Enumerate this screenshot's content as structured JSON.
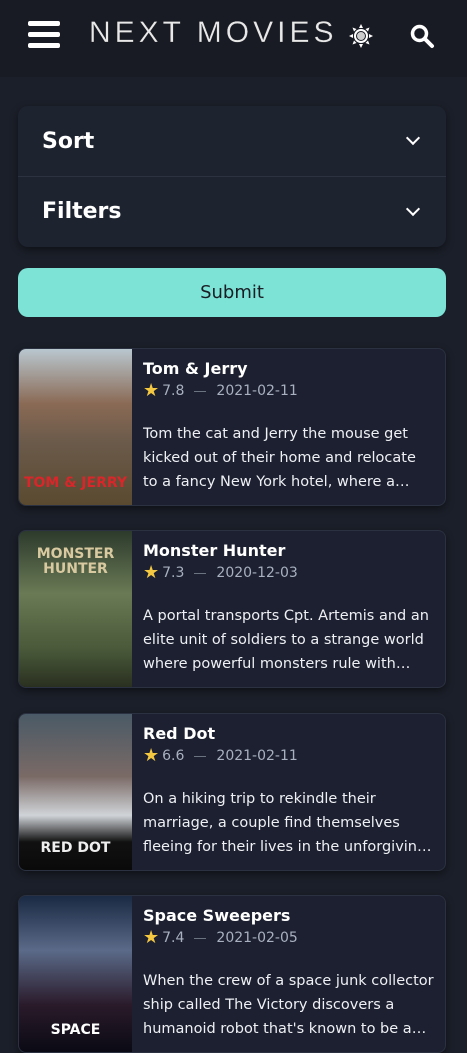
{
  "header": {
    "title": "NEXT MOVIES"
  },
  "sort_label": "Sort",
  "filters_label": "Filters",
  "submit_label": "Submit",
  "movies": [
    {
      "title": "Tom & Jerry",
      "rating": "7.8",
      "date": "2021-02-11",
      "overview": "Tom the cat and Jerry the mouse get kicked out of their home and relocate to a fancy New York hotel, where a scrappy employee named Kayla will lose her job if she can't evict Jerry before a high-class wedding at the hotel.",
      "poster_text": "TOM & JERRY"
    },
    {
      "title": "Monster Hunter",
      "rating": "7.3",
      "date": "2020-12-03",
      "overview": "A portal transports Cpt. Artemis and an elite unit of soldiers to a strange world where powerful monsters rule with deadly ferocity.",
      "poster_text": "MONSTER HUNTER"
    },
    {
      "title": "Red Dot",
      "rating": "6.6",
      "date": "2021-02-11",
      "overview": "On a hiking trip to rekindle their marriage, a couple find themselves fleeing for their lives in the unforgiving wilderness from an unknown shooter.",
      "poster_text": "RED DOT"
    },
    {
      "title": "Space Sweepers",
      "rating": "7.4",
      "date": "2021-02-05",
      "overview": "When the crew of a space junk collector ship called The Victory discovers a humanoid robot that's known to be a weapon of mass destruction, they get involved in a risky business deal.",
      "poster_text": "SPACE"
    }
  ]
}
